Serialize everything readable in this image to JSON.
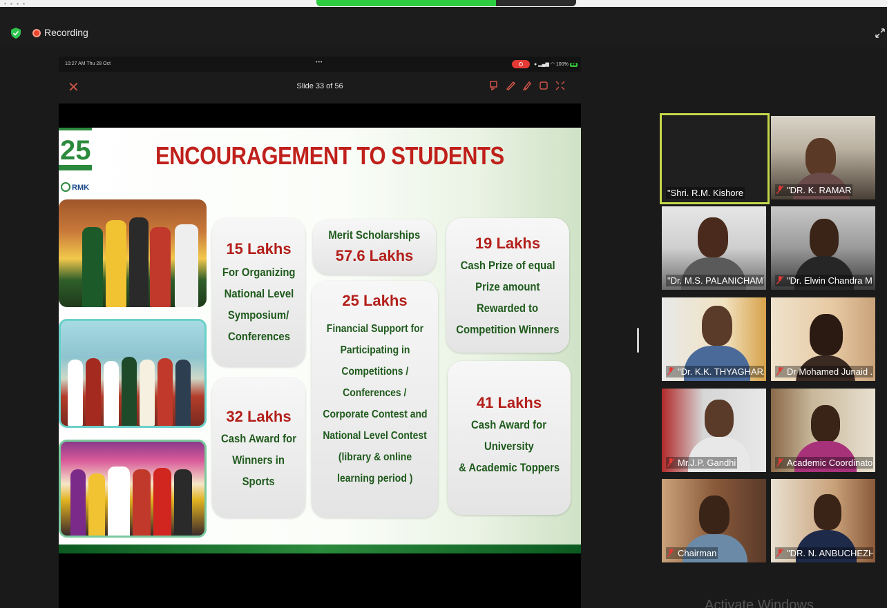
{
  "recording": {
    "label": "Recording"
  },
  "shared_screen": {
    "status_time": "10:27 AM  Thu 28 Oct",
    "status_center": "•••",
    "status_right": "100%",
    "slide_counter": "Slide 33 of 56",
    "slide": {
      "title": "ENCOURAGEMENT TO STUDENTS",
      "logo_text": "RMK",
      "cards": [
        {
          "amount": "15 Lakhs",
          "lines": [
            "For Organizing",
            "National Level",
            "Symposium/",
            "Conferences"
          ]
        },
        {
          "amount": "Merit Scholarships",
          "amount2": "57.6 Lakhs"
        },
        {
          "amount": "19 Lakhs",
          "lines": [
            "Cash Prize of equal",
            "Prize amount",
            "Rewarded to",
            "Competition Winners"
          ]
        },
        {
          "amount": "25 Lakhs",
          "lines": [
            "Financial Support for",
            "Participating in",
            "Competitions /",
            "Conferences /",
            "Corporate Contest and",
            "National Level Contest",
            "(library & online",
            "learning period )"
          ]
        },
        {
          "amount": "32 Lakhs",
          "lines": [
            "Cash Award for",
            "Winners in",
            "Sports"
          ]
        },
        {
          "amount": "41 Lakhs",
          "lines": [
            "Cash Award for",
            "University",
            "& Academic Toppers"
          ]
        }
      ]
    }
  },
  "participants": [
    {
      "name": "\"Shri. R.M. Kishore",
      "muted": false,
      "active": true
    },
    {
      "name": "\"DR. K. RAMAR",
      "muted": true
    },
    {
      "name": "\"Dr. M.S. PALANICHAMY",
      "muted": false
    },
    {
      "name": "\"Dr. Elwin Chandra M...",
      "muted": true
    },
    {
      "name": "\"Dr. K.K. THYAGHARA...",
      "muted": true
    },
    {
      "name": "Dr Mohamed Junaid ...",
      "muted": true
    },
    {
      "name": "Mr.J.P. Gandhi",
      "muted": true
    },
    {
      "name": "Academic Coordinator",
      "muted": true
    },
    {
      "name": "Chairman",
      "muted": true
    },
    {
      "name": "\"DR. N. ANBUCHEZHI...",
      "muted": true
    }
  ],
  "watermark": "Activate Windows",
  "colors": {
    "accent_active": "#c6d84a",
    "record": "#e8462c",
    "slide_title": "#c0201b",
    "slide_green": "#1f5a1c"
  }
}
